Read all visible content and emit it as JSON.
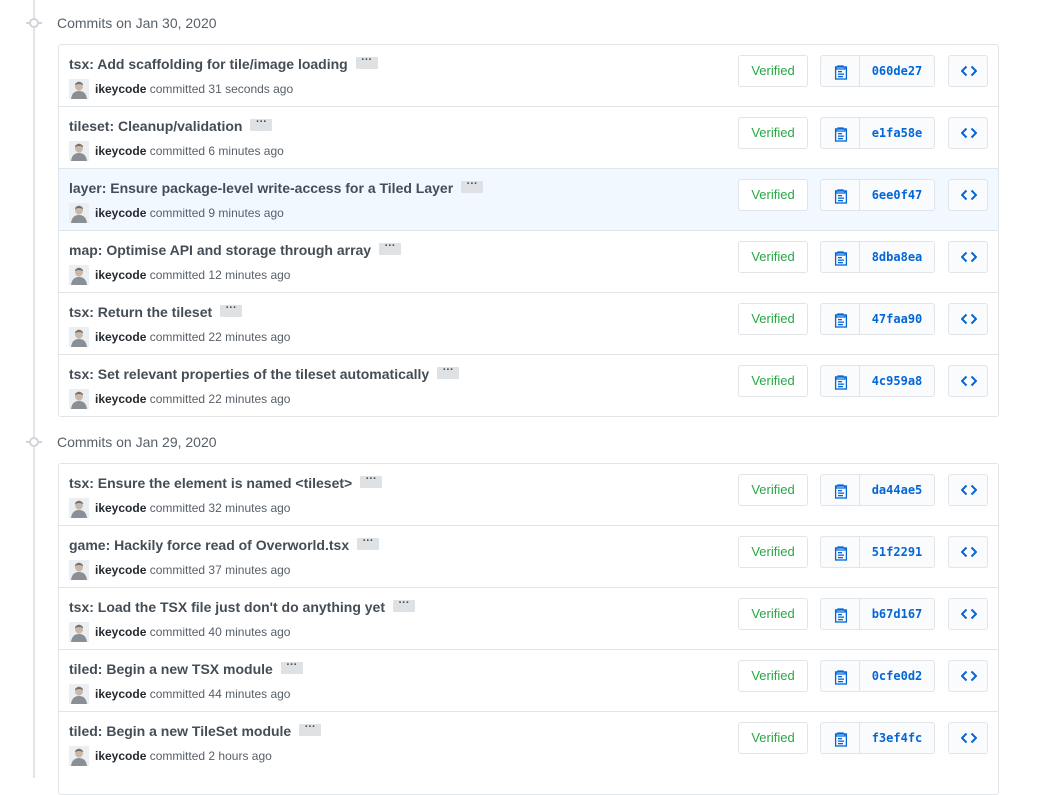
{
  "groups": [
    {
      "header": "Commits on Jan 30, 2020",
      "commits": [
        {
          "message": "tsx: Add scaffolding for tile/image loading",
          "author": "ikeycode",
          "action": "committed",
          "time": "31 seconds ago",
          "badge": "Verified",
          "sha": "060de27"
        },
        {
          "message": "tileset: Cleanup/validation",
          "author": "ikeycode",
          "action": "committed",
          "time": "6 minutes ago",
          "badge": "Verified",
          "sha": "e1fa58e"
        },
        {
          "message": "layer: Ensure package-level write-access for a Tiled Layer",
          "author": "ikeycode",
          "action": "committed",
          "time": "9 minutes ago",
          "badge": "Verified",
          "sha": "6ee0f47"
        },
        {
          "message": "map: Optimise API and storage through array",
          "author": "ikeycode",
          "action": "committed",
          "time": "12 minutes ago",
          "badge": "Verified",
          "sha": "8dba8ea"
        },
        {
          "message": "tsx: Return the tileset",
          "author": "ikeycode",
          "action": "committed",
          "time": "22 minutes ago",
          "badge": "Verified",
          "sha": "47faa90"
        },
        {
          "message": "tsx: Set relevant properties of the tileset automatically",
          "author": "ikeycode",
          "action": "committed",
          "time": "22 minutes ago",
          "badge": "Verified",
          "sha": "4c959a8"
        }
      ]
    },
    {
      "header": "Commits on Jan 29, 2020",
      "commits": [
        {
          "message": "tsx: Ensure the element is named <tileset>",
          "author": "ikeycode",
          "action": "committed",
          "time": "32 minutes ago",
          "badge": "Verified",
          "sha": "da44ae5"
        },
        {
          "message": "game: Hackily force read of Overworld.tsx",
          "author": "ikeycode",
          "action": "committed",
          "time": "37 minutes ago",
          "badge": "Verified",
          "sha": "51f2291"
        },
        {
          "message": "tsx: Load the TSX file just don't do anything yet",
          "author": "ikeycode",
          "action": "committed",
          "time": "40 minutes ago",
          "badge": "Verified",
          "sha": "b67d167"
        },
        {
          "message": "tiled: Begin a new TSX module",
          "author": "ikeycode",
          "action": "committed",
          "time": "44 minutes ago",
          "badge": "Verified",
          "sha": "0cfe0d2"
        },
        {
          "message": "tiled: Begin a new TileSet module",
          "author": "ikeycode",
          "action": "committed",
          "time": "2 hours ago",
          "badge": "Verified",
          "sha": "f3ef4fc"
        }
      ]
    }
  ],
  "icons": {
    "timeline": "git-commit-icon",
    "copy": "clipboard-icon",
    "browse": "code-icon",
    "ellipsis": "ellipsis-icon",
    "avatar": "avatar"
  },
  "colors": {
    "verified": "#28a745",
    "sha": "#0366d6",
    "highlight_row": "#f1f8ff",
    "border": "#e1e4e8"
  }
}
